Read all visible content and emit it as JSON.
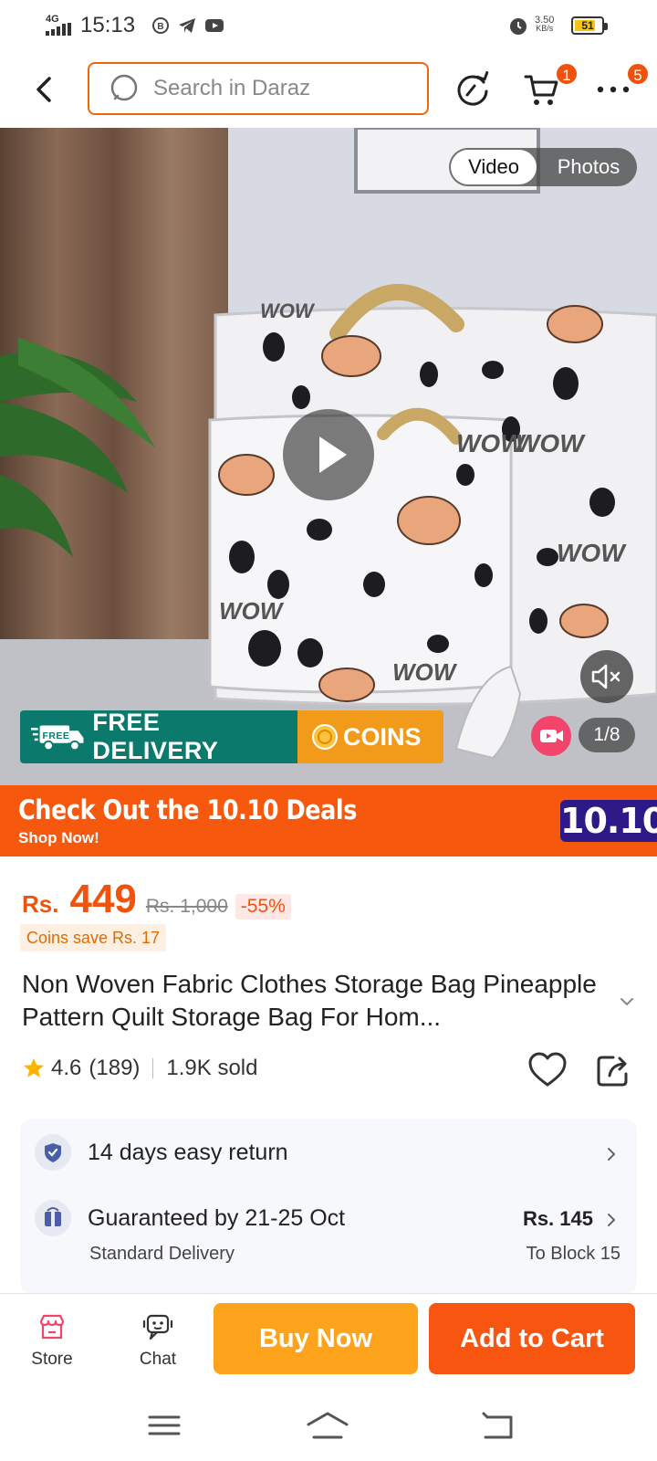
{
  "status_bar": {
    "time": "15:13",
    "network": "4G",
    "speed": "3.50",
    "speed_unit": "KB/s",
    "battery": "51"
  },
  "header": {
    "search_placeholder": "Search in Daraz",
    "cart_badge": "1",
    "more_badge": "5"
  },
  "gallery": {
    "toggle_active": "Video",
    "toggle_inactive": "Photos",
    "counter": "1/8",
    "promo_free_badge": "FREE",
    "promo_free": "FREE DELIVERY",
    "promo_coins": "COINS",
    "bag_print": "WOW"
  },
  "deals_banner": {
    "headline": "Check Out the 10.10 Deals",
    "subline": "Shop Now!",
    "tag": "10.10"
  },
  "product": {
    "currency": "Rs.",
    "price": "449",
    "original_price": "Rs. 1,000",
    "discount": "-55%",
    "coins_save": "Coins save Rs. 17",
    "title": "Non Woven Fabric Clothes Storage Bag Pineapple Pattern Quilt Storage Bag For Hom...",
    "rating": "4.6",
    "reviews": "(189)",
    "sold": "1.9K sold"
  },
  "services": {
    "return_text": "14 days easy return",
    "delivery_text": "Guaranteed by 21-25 Oct",
    "delivery_type": "Standard Delivery",
    "delivery_price": "Rs. 145",
    "delivery_location": "To Block 15"
  },
  "action_bar": {
    "store_label": "Store",
    "chat_label": "Chat",
    "buy_now": "Buy Now",
    "add_to_cart": "Add to Cart"
  },
  "colors": {
    "brand_orange": "#f75510",
    "buy_now": "#fea41c",
    "free_delivery": "#0b7a6c",
    "coins": "#f29a1a",
    "deals_tag": "#2e1a86"
  }
}
